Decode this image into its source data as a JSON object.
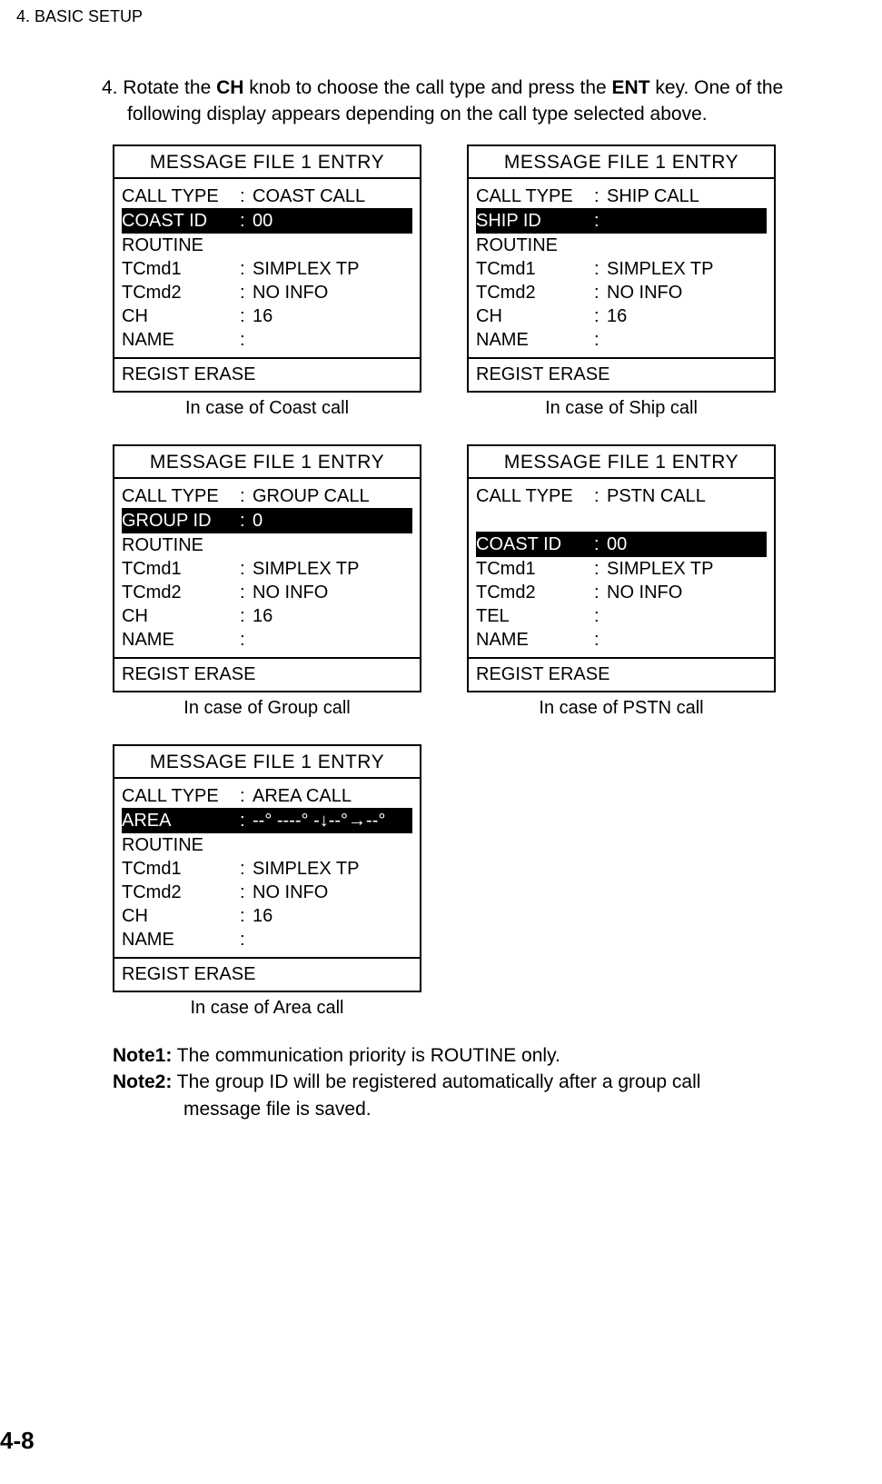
{
  "header": "4. BASIC SETUP",
  "instruction": {
    "line1_pre": "4. Rotate the ",
    "line1_strong1": "CH",
    "line1_mid": " knob to choose the call type and press the ",
    "line1_strong2": "ENT",
    "line1_post": " key. One of the",
    "line2": "following display appears depending on the call type selected above."
  },
  "panels": {
    "coast": {
      "title": "MESSAGE FILE 1 ENTRY",
      "calltype_label": "CALL TYPE",
      "calltype_val": "COAST CALL",
      "hi_label": "COAST ID",
      "hi_val": "00",
      "routine": "ROUTINE",
      "tcmd1_label": "TCmd1",
      "tcmd1_val": "SIMPLEX TP",
      "tcmd2_label": "TCmd2",
      "tcmd2_val": "NO INFO",
      "ch_label": "CH",
      "ch_val": "16",
      "name_label": "NAME",
      "name_val": "",
      "footer": "REGIST ERASE",
      "caption": "In case of Coast call"
    },
    "ship": {
      "title": "MESSAGE FILE 1 ENTRY",
      "calltype_label": "CALL TYPE",
      "calltype_val": "SHIP CALL",
      "hi_label": "SHIP ID",
      "hi_val": "",
      "routine": "ROUTINE",
      "tcmd1_label": "TCmd1",
      "tcmd1_val": "SIMPLEX TP",
      "tcmd2_label": "TCmd2",
      "tcmd2_val": "NO INFO",
      "ch_label": "CH",
      "ch_val": "16",
      "name_label": "NAME",
      "name_val": "",
      "footer": "REGIST ERASE",
      "caption": "In case of Ship call"
    },
    "group": {
      "title": "MESSAGE FILE 1 ENTRY",
      "calltype_label": "CALL TYPE",
      "calltype_val": "GROUP CALL",
      "hi_label": "GROUP ID",
      "hi_val": "0",
      "routine": "ROUTINE",
      "tcmd1_label": "TCmd1",
      "tcmd1_val": "SIMPLEX TP",
      "tcmd2_label": "TCmd2",
      "tcmd2_val": "NO INFO",
      "ch_label": "CH",
      "ch_val": "16",
      "name_label": "NAME",
      "name_val": "",
      "footer": "REGIST ERASE",
      "caption": "In case of Group call"
    },
    "pstn": {
      "title": "MESSAGE FILE 1 ENTRY",
      "calltype_label": "CALL TYPE",
      "calltype_val": "PSTN CALL",
      "hi_label": "COAST ID",
      "hi_val": "00",
      "tcmd1_label": "TCmd1",
      "tcmd1_val": "SIMPLEX TP",
      "tcmd2_label": "TCmd2",
      "tcmd2_val": "NO INFO",
      "tel_label": "TEL",
      "tel_val": "",
      "name_label": "NAME",
      "name_val": "",
      "footer": "REGIST ERASE",
      "caption": "In case of PSTN call"
    },
    "area": {
      "title": "MESSAGE FILE 1 ENTRY",
      "calltype_label": "CALL TYPE",
      "calltype_val": "AREA CALL",
      "hi_label": "AREA",
      "hi_val": "--° ----° -↓--°→--°",
      "routine": "ROUTINE",
      "tcmd1_label": "TCmd1",
      "tcmd1_val": "SIMPLEX TP",
      "tcmd2_label": "TCmd2",
      "tcmd2_val": "NO INFO",
      "ch_label": "CH",
      "ch_val": "16",
      "name_label": "NAME",
      "name_val": "",
      "footer": "REGIST ERASE",
      "caption": "In case of Area call"
    }
  },
  "notes": {
    "note1_label": "Note1:",
    "note1_text": " The communication priority is ROUTINE only.",
    "note2_label": "Note2:",
    "note2_text": " The group ID will be registered automatically after a group call",
    "note2_text2": "message file is saved."
  },
  "page_num": "4-8"
}
